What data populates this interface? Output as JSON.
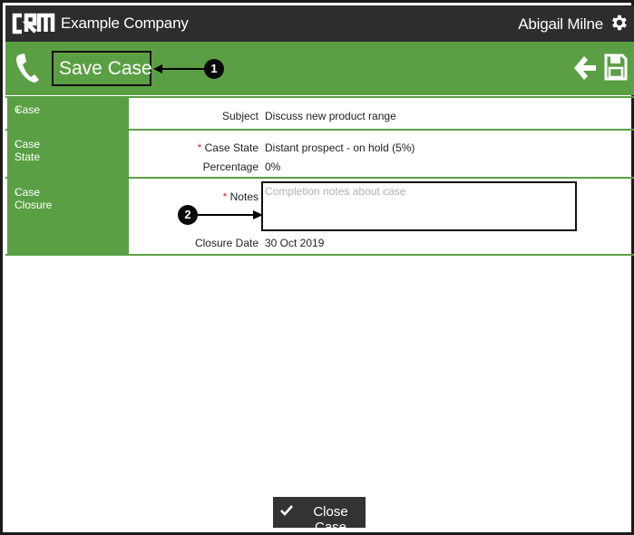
{
  "header": {
    "logo_text": "CRM",
    "company": "Example Company",
    "user_name": "Abigail Milne",
    "icons": [
      "crm-logo",
      "gear-icon"
    ]
  },
  "action_bar": {
    "title": "Save Case",
    "icons": [
      "phone-icon",
      "back-arrow-icon",
      "save-icon"
    ],
    "accent_color": "#5b9f44"
  },
  "callouts": {
    "one": "1",
    "two": "2"
  },
  "sections": {
    "case": {
      "toggle": "+",
      "label": "Case",
      "fields": {
        "subject_label": "Subject",
        "subject_value": "Discuss new product range"
      }
    },
    "case_state": {
      "toggle": "-",
      "label": "Case State",
      "fields": {
        "required_mark": "*",
        "state_label": "Case State",
        "state_value": "Distant prospect - on hold (5%)",
        "percentage_label": "Percentage",
        "percentage_value": "0%"
      }
    },
    "case_closure": {
      "toggle": "-",
      "label": "Case Closure",
      "fields": {
        "required_mark": "*",
        "notes_label": "Notes",
        "notes_placeholder": "Completion notes about case",
        "notes_value": "",
        "closure_date_label": "Closure Date",
        "closure_date_value": "30 Oct 2019"
      }
    }
  },
  "footer": {
    "close_button_label": "Close Case"
  }
}
